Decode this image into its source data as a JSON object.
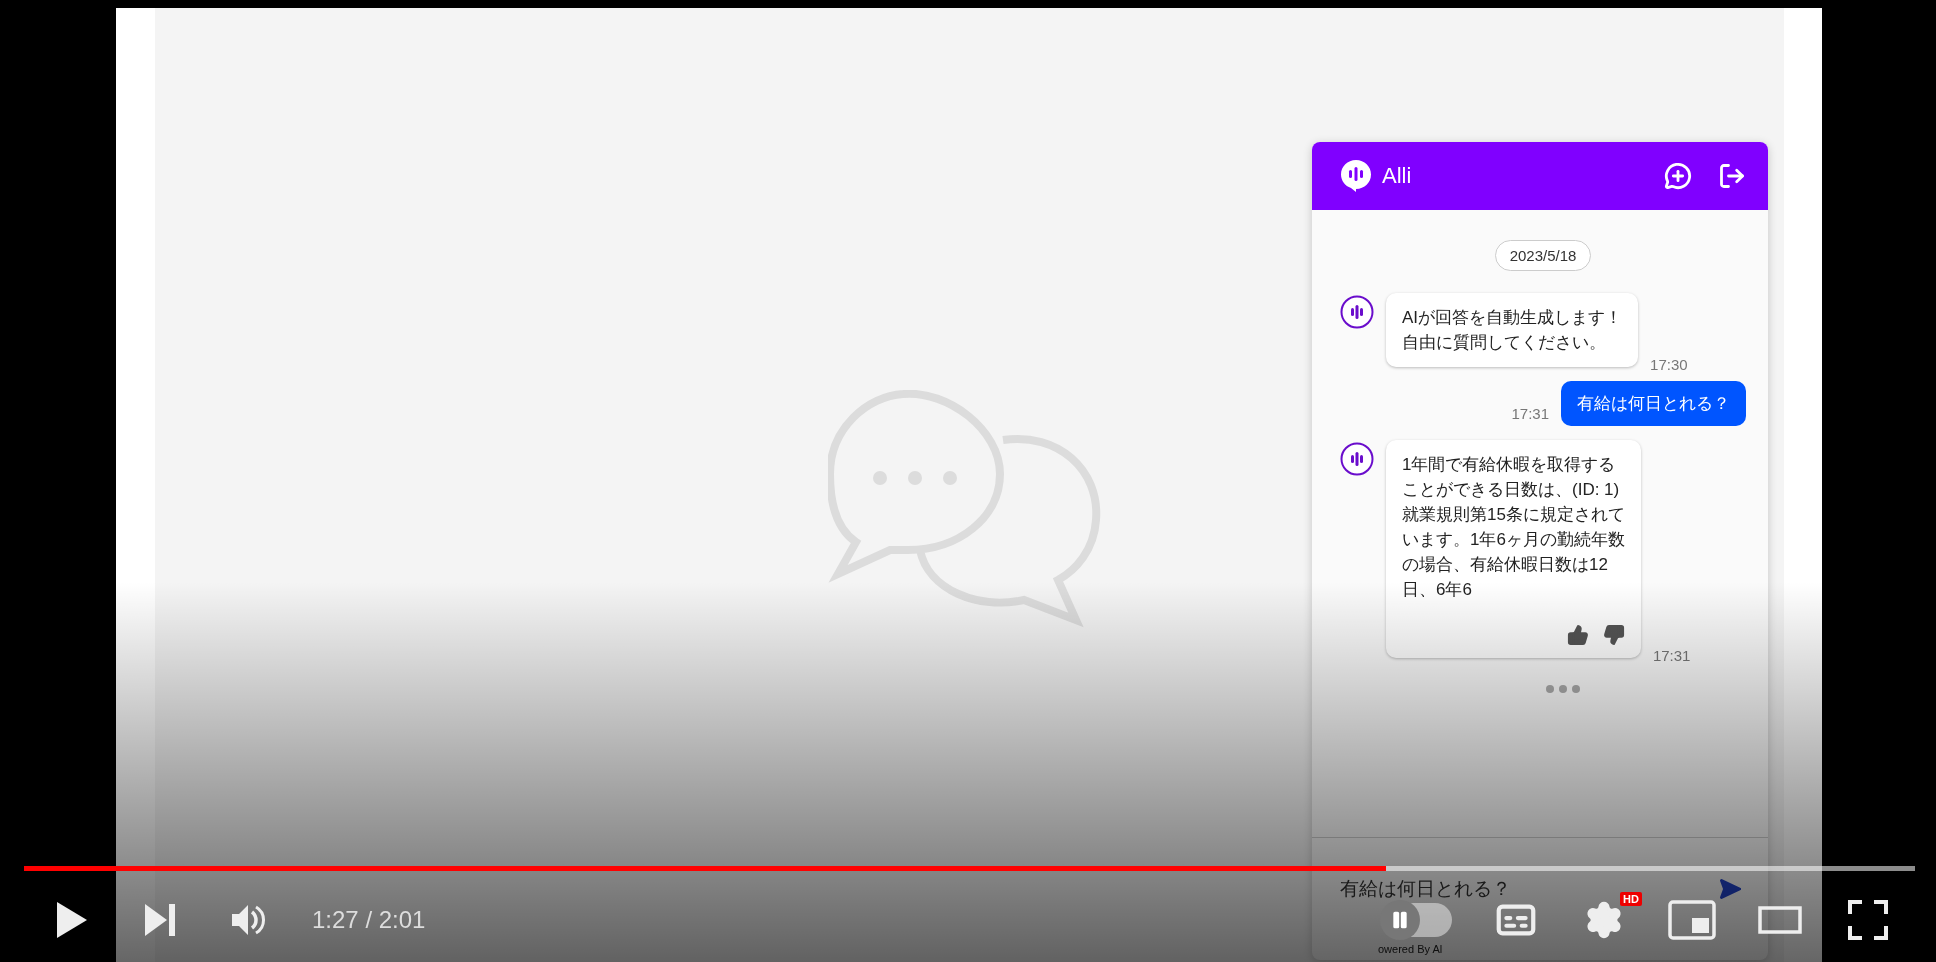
{
  "chat_widget": {
    "title": "Alli",
    "date": "2023/5/18",
    "messages": [
      {
        "kind": "bot",
        "lines": [
          "AIが回答を自動生成します！",
          "自由に質問してください。"
        ],
        "time": "17:30",
        "feedback": false
      },
      {
        "kind": "user",
        "lines": [
          "有給は何日とれる？"
        ],
        "time": "17:31"
      },
      {
        "kind": "bot",
        "lines": [
          "1年間で有給休暇を取得する",
          "ことができる日数は、(ID: 1)",
          "就業規則第15条に規定されて",
          "います。1年6ヶ月の勤続年数",
          "の場合、有給休暇日数は12",
          "日、6年6"
        ],
        "time": "17:31",
        "feedback": true
      }
    ],
    "typing": true,
    "input": {
      "value": "有給は何日とれる？"
    },
    "footer": "owered By Al"
  },
  "player": {
    "progress": {
      "level": 0.72
    },
    "time": "1:27 / 2:01",
    "autoplay": {
      "on": false
    },
    "quality_badge": "HD"
  }
}
